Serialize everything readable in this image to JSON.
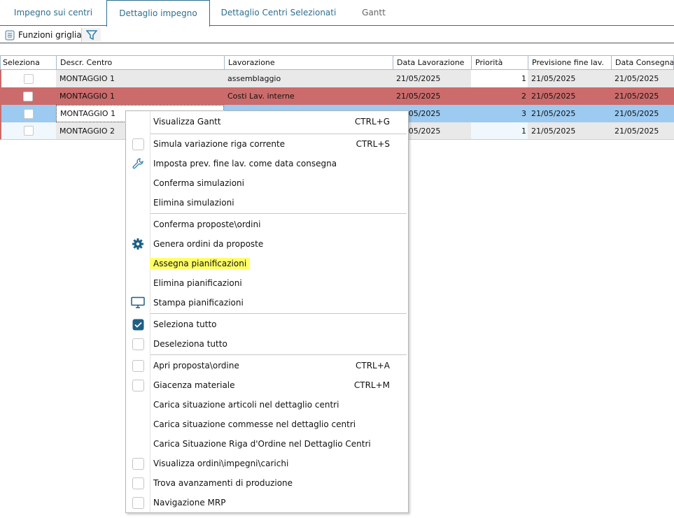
{
  "tabs": [
    "Impegno sui centri",
    "Dettaglio impegno",
    "Dettaglio Centri Selezionati",
    "Gantt"
  ],
  "toolbar": {
    "grid_functions": "Funzioni griglia"
  },
  "grid": {
    "columns": [
      "Seleziona",
      "Descr. Centro",
      "Lavorazione",
      "Data Lavorazione",
      "Priorità",
      "Previsione fine lav.",
      "Data Consegna"
    ],
    "rows": [
      {
        "centro": "MONTAGGIO 1",
        "lavorazione": "assemblaggio",
        "data": "21/05/2025",
        "priorita": "1",
        "prev": "21/05/2025",
        "consegna": "21/05/2025"
      },
      {
        "centro": "MONTAGGIO 1",
        "lavorazione": "Costi Lav. interne",
        "data": "21/05/2025",
        "priorita": "2",
        "prev": "21/05/2025",
        "consegna": "21/05/2025"
      },
      {
        "centro": "MONTAGGIO 1",
        "lavorazione": "",
        "data": "21/05/2025",
        "priorita": "3",
        "prev": "21/05/2025",
        "consegna": "21/05/2025"
      },
      {
        "centro": "MONTAGGIO 2",
        "lavorazione": "",
        "data": "21/05/2025",
        "priorita": "1",
        "prev": "21/05/2025",
        "consegna": "21/05/2025"
      }
    ]
  },
  "menu": [
    {
      "label": "Visualizza Gantt",
      "shortcut": "CTRL+G",
      "icon": ""
    },
    {
      "label": "Simula variazione riga corrente",
      "shortcut": "CTRL+S",
      "icon": "checkbox"
    },
    {
      "label": "Imposta prev. fine lav. come data consegna",
      "shortcut": "",
      "icon": "wrench-icon"
    },
    {
      "label": "Conferma simulazioni",
      "shortcut": "",
      "icon": ""
    },
    {
      "label": "Elimina simulazioni",
      "shortcut": "",
      "icon": ""
    },
    {
      "label": "Conferma proposte\\ordini",
      "shortcut": "",
      "icon": ""
    },
    {
      "label": "Genera ordini da proposte",
      "shortcut": "",
      "icon": "gear-icon"
    },
    {
      "label": "Assegna pianificazioni",
      "shortcut": "",
      "icon": ""
    },
    {
      "label": "Elimina pianificazioni",
      "shortcut": "",
      "icon": ""
    },
    {
      "label": "Stampa pianificazioni",
      "shortcut": "",
      "icon": "monitor-icon"
    },
    {
      "label": "Seleziona tutto",
      "shortcut": "",
      "icon": "checked"
    },
    {
      "label": "Deseleziona tutto",
      "shortcut": "",
      "icon": "checkbox"
    },
    {
      "label": "Apri proposta\\ordine",
      "shortcut": "CTRL+A",
      "icon": "checkbox"
    },
    {
      "label": "Giacenza materiale",
      "shortcut": "CTRL+M",
      "icon": "checkbox"
    },
    {
      "label": "Carica situazione articoli nel dettaglio centri",
      "shortcut": "",
      "icon": ""
    },
    {
      "label": "Carica situazione commesse nel dettaglio centri",
      "shortcut": "",
      "icon": ""
    },
    {
      "label": "Carica Situazione Riga d'Ordine nel Dettaglio Centri",
      "shortcut": "",
      "icon": ""
    },
    {
      "label": "Visualizza ordini\\impegni\\carichi",
      "shortcut": "",
      "icon": "checkbox"
    },
    {
      "label": "Trova avanzamenti di produzione",
      "shortcut": "",
      "icon": "checkbox"
    },
    {
      "label": "Navigazione MRP",
      "shortcut": "",
      "icon": "checkbox"
    }
  ],
  "colors": {
    "accent": "#2e6f8e",
    "row_red": "#cc6b6b",
    "row_selected": "#9ccaf0",
    "highlight": "#ffff66"
  }
}
